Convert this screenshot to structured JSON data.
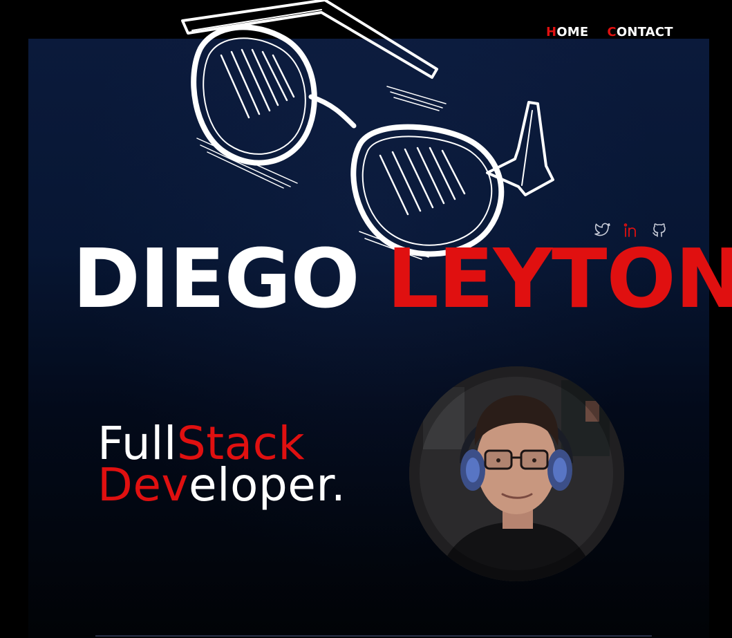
{
  "nav": {
    "items": [
      {
        "first": "H",
        "rest": "OME"
      },
      {
        "first": "C",
        "rest": "ONTACT"
      }
    ]
  },
  "social": {
    "icons": [
      "twitter-icon",
      "linkedin-icon",
      "github-icon"
    ]
  },
  "hero": {
    "first_name": "DIEGO",
    "last_name": "LEYTON",
    "role_line1_white": "Full",
    "role_line1_red": "Stack",
    "role_line2_red": "Dev",
    "role_line2_white": "eloper."
  },
  "colors": {
    "accent": "#e01010",
    "text": "#ffffff",
    "background": "#000000",
    "panel_top": "#0b1a3b"
  }
}
